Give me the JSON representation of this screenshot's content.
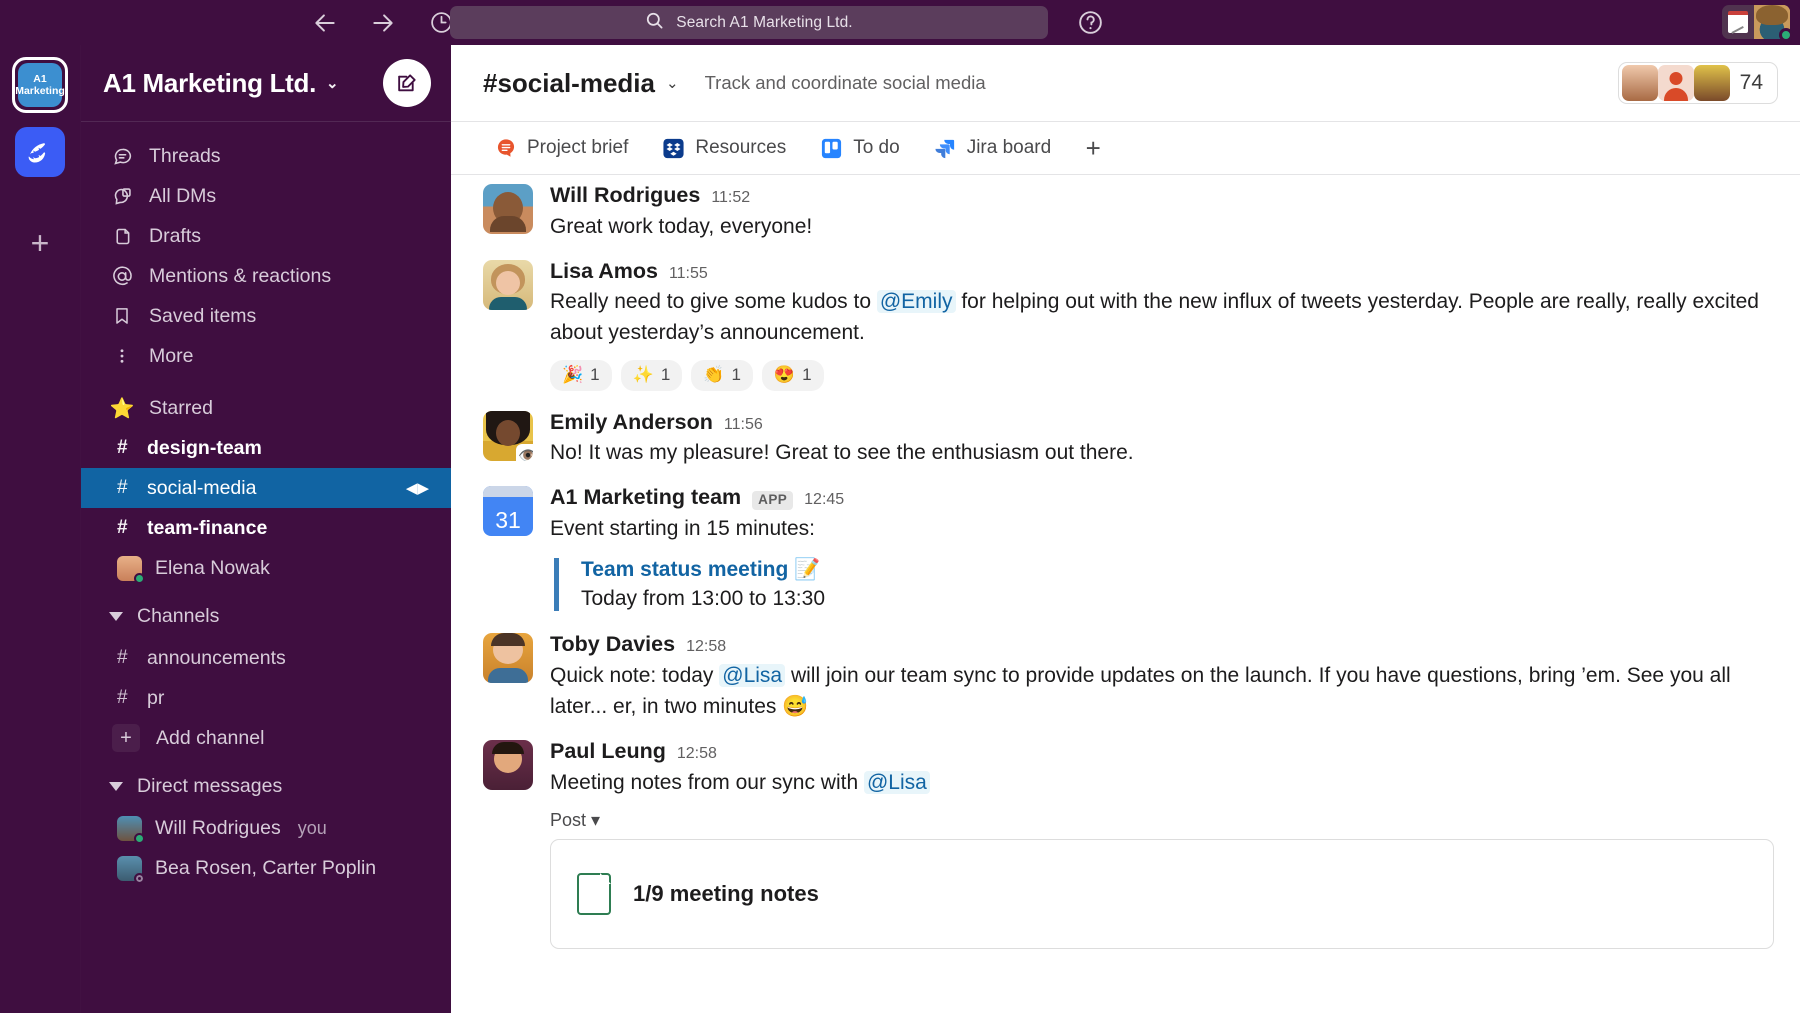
{
  "topbar": {
    "back_icon": "arrow-left-icon",
    "forward_icon": "arrow-right-icon",
    "history_icon": "clock-icon",
    "search_placeholder": "Search A1 Marketing Ltd.",
    "search_icon": "search-icon",
    "help_icon": "question-circle-icon",
    "calendar_icon": "calendar-icon",
    "avatar_icon": "user-avatar"
  },
  "rail": {
    "active_workspace": {
      "line1": "A1",
      "line2": "Marketing"
    },
    "other_workspace_icon": "croissant-icon",
    "add_workspace_icon": "plus-icon"
  },
  "sidebar": {
    "workspace_title": "A1 Marketing Ltd.",
    "workspace_caret": "⌄",
    "compose_icon": "compose-icon",
    "nav": [
      {
        "label": "Threads",
        "icon": "threads-icon"
      },
      {
        "label": "All DMs",
        "icon": "dms-icon"
      },
      {
        "label": "Drafts",
        "icon": "drafts-icon"
      },
      {
        "label": "Mentions & reactions",
        "icon": "at-icon"
      },
      {
        "label": "Saved items",
        "icon": "bookmark-icon"
      },
      {
        "label": "More",
        "icon": "more-vertical-icon"
      }
    ],
    "starred": {
      "label": "Starred",
      "icon": "star-icon"
    },
    "starred_items": [
      {
        "label": "design-team",
        "type": "channel",
        "unread": true
      },
      {
        "label": "social-media",
        "type": "channel",
        "active": true
      },
      {
        "label": "team-finance",
        "type": "channel",
        "unread": true
      },
      {
        "label": "Elena Nowak",
        "type": "dm",
        "presence": "active"
      }
    ],
    "channels_section": {
      "label": "Channels"
    },
    "channels": [
      {
        "label": "announcements"
      },
      {
        "label": "pr"
      }
    ],
    "add_channel": {
      "label": "Add channel",
      "icon": "plus-icon"
    },
    "dm_section": {
      "label": "Direct messages"
    },
    "dms": [
      {
        "label": "Will Rodrigues",
        "suffix": "you",
        "presence": "active"
      },
      {
        "label": "Bea Rosen, Carter Poplin",
        "presence": "away"
      }
    ]
  },
  "channel": {
    "name": "#social-media",
    "caret": "⌄",
    "topic": "Track and coordinate social media",
    "member_count": "74",
    "tabs": [
      {
        "label": "Project brief",
        "icon": "brief-icon"
      },
      {
        "label": "Resources",
        "icon": "dropbox-icon"
      },
      {
        "label": "To do",
        "icon": "trello-icon"
      },
      {
        "label": "Jira board",
        "icon": "jira-icon"
      }
    ],
    "add_tab_icon": "plus-icon"
  },
  "messages": [
    {
      "author": "Will Rodrigues",
      "time": "11:52",
      "text": "Great work today, everyone!"
    },
    {
      "author": "Lisa Amos",
      "time": "11:55",
      "text_pre": "Really need to give some kudos to ",
      "mention": "@Emily",
      "text_post": " for helping out with the new influx of tweets yesterday. People are really, really excited about yesterday’s announcement.",
      "reactions": [
        {
          "emoji": "🎉",
          "count": "1"
        },
        {
          "emoji": "✨",
          "count": "1"
        },
        {
          "emoji": "👏",
          "count": "1"
        },
        {
          "emoji": "😍",
          "count": "1"
        }
      ]
    },
    {
      "author": "Emily Anderson",
      "time": "11:56",
      "text": "No! It was my pleasure! Great to see the enthusiasm out there.",
      "status_emoji": "👁️"
    },
    {
      "author": "A1 Marketing team",
      "badge": "APP",
      "time": "12:45",
      "text": "Event starting in 15 minutes:",
      "quote_title": "Team status meeting 📝",
      "quote_sub": "Today from 13:00 to 13:30"
    },
    {
      "author": "Toby Davies",
      "time": "12:58",
      "text_pre": "Quick note: today ",
      "mention": "@Lisa",
      "text_post": " will join our team sync to provide updates on the launch. If you have questions, bring ’em. See you all later... er, in two minutes 😅"
    },
    {
      "author": "Paul Leung",
      "time": "12:58",
      "text_pre": "Meeting notes from our sync with ",
      "mention": "@Lisa",
      "text_post": "",
      "post_label": "Post ▾",
      "post_title": "1/9 meeting notes"
    }
  ],
  "colors": {
    "sidebar_bg": "#3F0E40",
    "active_channel": "#1164A3",
    "mention_blue": "#1264A3",
    "accent_green": "#2BAC76"
  }
}
